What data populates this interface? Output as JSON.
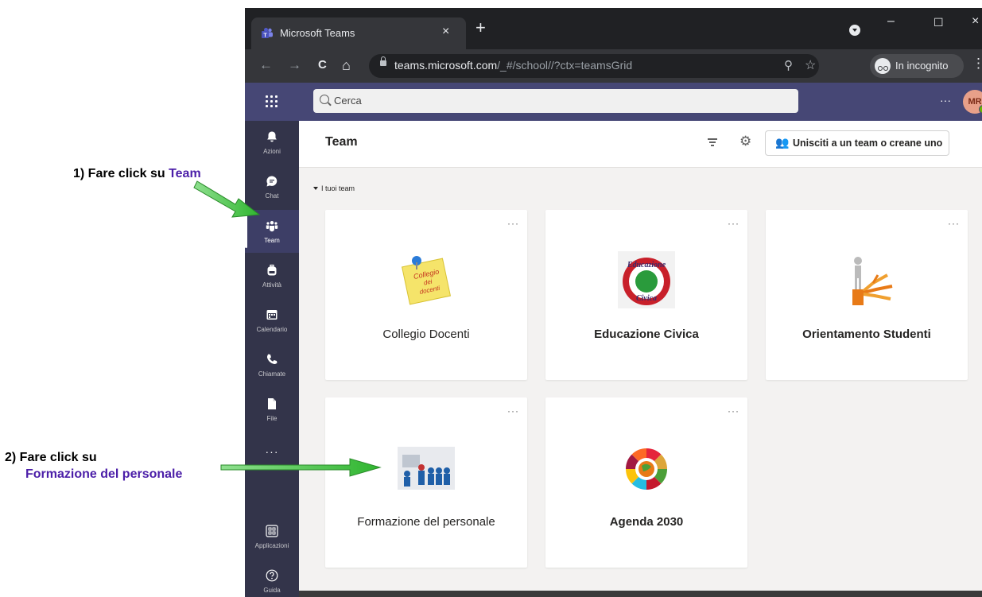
{
  "annotations": {
    "step1": {
      "prefix": "1) Fare click su ",
      "highlight": "Team"
    },
    "step2": {
      "line1": "2) Fare click su",
      "highlight": "Formazione del personale"
    },
    "arrow_color": "#3cc43c"
  },
  "browser": {
    "tab_title": "Microsoft Teams",
    "tab_close": "×",
    "new_tab": "+",
    "window_controls": {
      "minimize": "–",
      "maximize": "☐",
      "close": "×"
    },
    "nav": {
      "back": "←",
      "forward": "→",
      "reload": "C",
      "home": "⌂"
    },
    "url_host": "teams.microsoft.com",
    "url_path": "/_#/school//?ctx=teamsGrid",
    "incognito_label": "In incognito",
    "menu": "⋮"
  },
  "teams_header": {
    "search_placeholder": "Cerca",
    "more": "···",
    "avatar_initials": "MR"
  },
  "rail": {
    "items": [
      {
        "label": "Azioni",
        "icon": "bell-icon"
      },
      {
        "label": "Chat",
        "icon": "chat-icon"
      },
      {
        "label": "Team",
        "icon": "team-icon",
        "active": true
      },
      {
        "label": "Attività",
        "icon": "backpack-icon"
      },
      {
        "label": "Calendario",
        "icon": "calendar-icon"
      },
      {
        "label": "Chiamate",
        "icon": "phone-icon"
      },
      {
        "label": "File",
        "icon": "file-icon"
      }
    ],
    "more": "···",
    "bottom_items": [
      {
        "label": "Applicazioni",
        "icon": "apps-icon"
      },
      {
        "label": "Guida",
        "icon": "help-icon"
      }
    ]
  },
  "main": {
    "title": "Team",
    "join_button": "Unisciti a un team o creane uno",
    "section": "I tuoi team",
    "card_more": "···",
    "teams": [
      {
        "name": "Collegio Docenti",
        "bold": false,
        "image": "collegio-docenti-image"
      },
      {
        "name": "Educazione Civica",
        "bold": true,
        "image": "educazione-civica-image"
      },
      {
        "name": "Orientamento Studenti",
        "bold": true,
        "image": "orientamento-studenti-image"
      },
      {
        "name": "Formazione del personale",
        "bold": false,
        "image": "formazione-personale-image"
      },
      {
        "name": "Agenda 2030",
        "bold": true,
        "image": "agenda-2030-image"
      }
    ],
    "images": {
      "collegio_text": "Collegio dei docenti",
      "educazione_text_1": "Educazione",
      "educazione_text_2": "Civica"
    }
  },
  "colors": {
    "teams_purple": "#464775",
    "rail": "#33344a",
    "highlight_text": "#4b1ea8"
  }
}
